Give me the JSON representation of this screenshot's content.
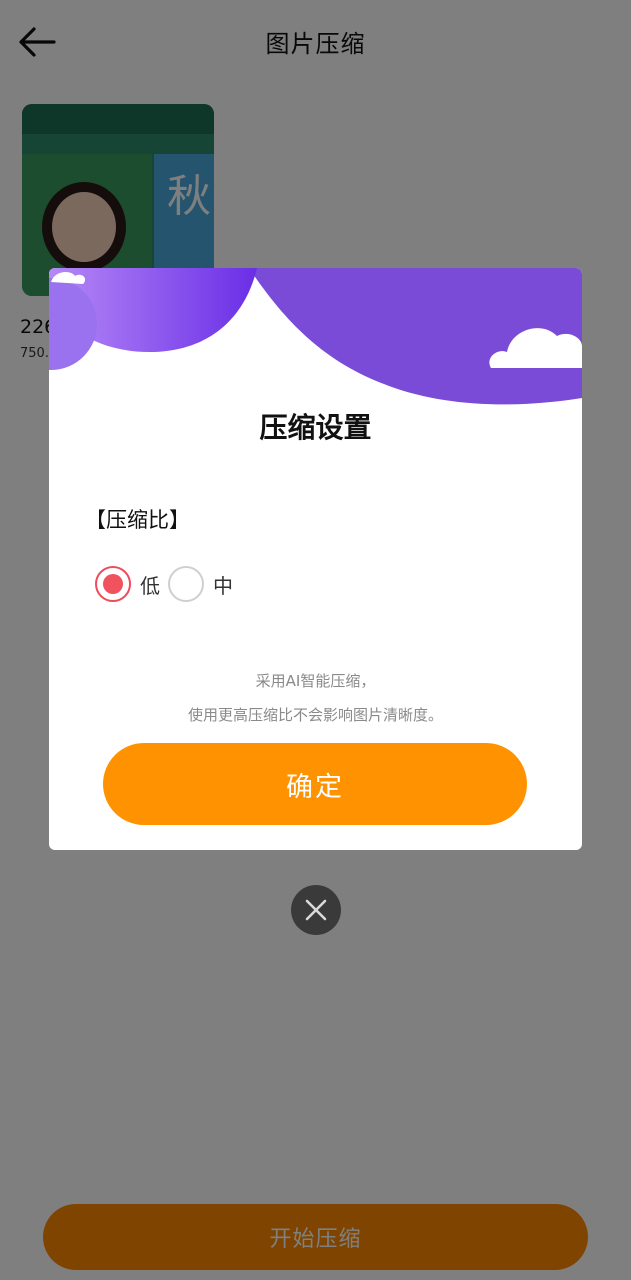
{
  "header": {
    "title": "图片压缩",
    "back_icon": "arrow-left-icon"
  },
  "file": {
    "name": "226",
    "size": "750.",
    "thumbnail_char": "秋"
  },
  "footer": {
    "start_label": "开始压缩"
  },
  "dialog": {
    "title": "压缩设置",
    "ratio_label": "【压缩比】",
    "options": [
      {
        "label": "低",
        "checked": true
      },
      {
        "label": "中",
        "checked": false
      }
    ],
    "hint_line1": "采用AI智能压缩，",
    "hint_line2": "使用更高压缩比不会影响图片清晰度。",
    "confirm_label": "确定",
    "close_icon": "close-icon"
  },
  "colors": {
    "accent_orange": "#ff9200",
    "header_purple": "#7a4bd6",
    "radio_checked": "#f0525e"
  }
}
